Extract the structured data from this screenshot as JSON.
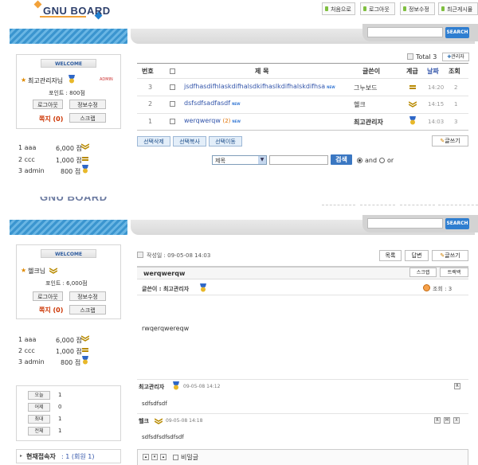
{
  "site": {
    "logo_text": "GNU BOARD"
  },
  "top_nav": [
    {
      "label": "처음으로"
    },
    {
      "label": "로그아웃"
    },
    {
      "label": "정보수정"
    },
    {
      "label": "최근게시물"
    }
  ],
  "search": {
    "button_label": "SEARCH",
    "placeholder": ""
  },
  "colors": {
    "accent_blue": "#2f7ed0",
    "stripe_blue": "#3b95cf",
    "highlight_red": "#cc3300",
    "link_blue": "#3355aa"
  },
  "sidebar": {
    "welcome": "WELCOME",
    "user_name": "최고관리자님",
    "admin_badge": "ADMIN",
    "points": "포인트 : 800점",
    "logout": "로그아웃",
    "edit_info": "정보수정",
    "memo": "쪽지 (0)",
    "scrap": "스크랩",
    "ranking": [
      {
        "rank_name": "1 aaa",
        "points": "6,000 점"
      },
      {
        "rank_name": "2 ccc",
        "points": "1,000 점"
      },
      {
        "rank_name": "3 admin",
        "points": "800 점"
      }
    ]
  },
  "sidebar2": {
    "welcome": "WELCOME",
    "user_name": "헬크님",
    "points": "포인트 : 6,000점",
    "logout": "로그아웃",
    "edit_info": "정보수정",
    "memo": "쪽지 (0)",
    "scrap": "스크랩",
    "ranking": [
      {
        "rank_name": "1 aaa",
        "points": "6,000 점"
      },
      {
        "rank_name": "2 ccc",
        "points": "1,000 점"
      },
      {
        "rank_name": "3 admin",
        "points": "800 점"
      }
    ],
    "visit_stats": [
      {
        "label": "오늘",
        "value": "1"
      },
      {
        "label": "어제",
        "value": "0"
      },
      {
        "label": "최대",
        "value": "1"
      },
      {
        "label": "전체",
        "value": "1"
      }
    ],
    "current_users_label": "현재접속자",
    "current_users_value": " : 1 (회원 1)"
  },
  "board": {
    "total": "Total 3",
    "admin_label": "관리자",
    "columns": {
      "num": "번호",
      "subject": "제  목",
      "writer": "글쓴이",
      "level": "계급",
      "date": "날짜",
      "hits": "조회"
    },
    "rows": [
      {
        "num": "3",
        "subject": "jsdfhasdifhlaskdifhalsdkifhaslkdifhalskdifhsa",
        "comments": "",
        "writer": "그누보드",
        "date": "14:20",
        "hits": "2"
      },
      {
        "num": "2",
        "subject": "dsfsdfsadfasdf",
        "comments": "",
        "writer": "헬크",
        "date": "14:15",
        "hits": "1"
      },
      {
        "num": "1",
        "subject": "werqwerqw",
        "comments": "(2)",
        "writer": "최고관리자",
        "date": "14:03",
        "hits": "3"
      }
    ],
    "new_tag": "NEW",
    "actions": {
      "delete_selected": "선택삭제",
      "copy_selected": "선택복사",
      "move_selected": "선택이동",
      "write": "글쓰기"
    },
    "search": {
      "select_value": "제목",
      "button": "검색",
      "and": "and",
      "or": "or"
    }
  },
  "view": {
    "date": "작성일 : 09-05-08 14:03",
    "buttons": {
      "list": "목록",
      "reply": "답변",
      "write": "글쓰기",
      "scrap": "스크랩",
      "trackback": "트랙백"
    },
    "title": "werqwerqw",
    "writer_label": "글쓴이 : 최고관리자",
    "hits": "조회 : 3",
    "content": "rwqerqwereqw",
    "comments": [
      {
        "author": "최고관리자",
        "date": "09-05-08 14:12",
        "text": "sdfsdfsdf",
        "actions": [
          "R"
        ]
      },
      {
        "author": "헬크",
        "date": "09-05-08 14:18",
        "text": "sdfsdfsdfsdfsdf",
        "actions": [
          "R",
          "M",
          "X"
        ]
      }
    ],
    "editor_secret": "비밀글"
  }
}
